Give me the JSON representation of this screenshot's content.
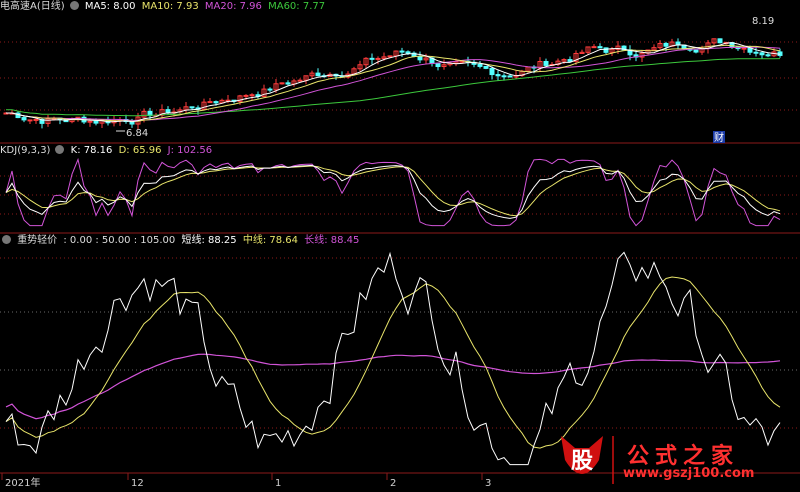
{
  "colors": {
    "bg": "#000000",
    "up": "#ff3c3c",
    "down": "#54ffff",
    "ma5": "#ffffff",
    "ma10": "#e8e46a",
    "ma20": "#d254d8",
    "ma60": "#3cc83c",
    "k": "#ffffff",
    "d": "#e8e46a",
    "j": "#d254d8",
    "short": "#ffffff",
    "mid": "#e8e46a",
    "long": "#d254d8",
    "grid": "#8b1a1a",
    "gridDot": "#6a6a6a",
    "axis": "#8b1a1a"
  },
  "panel1": {
    "title": "电高速A(日线)",
    "settings_icon": "gear-icon",
    "ma5": "MA5: 8.00",
    "ma10": "MA10: 7.93",
    "ma20": "MA20: 7.96",
    "ma60": "MA60: 7.77",
    "low_label": "6.84",
    "high_label": "8.19",
    "event_label": "财"
  },
  "panel2": {
    "title": "KDJ(9,3,3)",
    "settings_icon": "gear-icon",
    "k": "K: 78.16",
    "d": "D: 65.96",
    "j": "J: 102.56"
  },
  "panel3": {
    "title": "重势轻价",
    "settings_icon": "gear-icon",
    "levels": ": 0.00 : 50.00 : 105.00",
    "short": "短线: 88.25",
    "mid": "中线: 78.64",
    "long": "长线: 88.45"
  },
  "xaxis": {
    "labels": [
      "2021年",
      "12",
      "1",
      "2",
      "3"
    ]
  },
  "watermark": {
    "char": "股",
    "text": "公式之家",
    "url": "www.gszj100.com"
  },
  "chart_data": [
    {
      "type": "candlestick",
      "title": "电高速A(日线)",
      "series": [
        {
          "name": "MA5",
          "value": 8.0
        },
        {
          "name": "MA10",
          "value": 7.93
        },
        {
          "name": "MA20",
          "value": 7.96
        },
        {
          "name": "MA60",
          "value": 7.77
        }
      ],
      "annotations": [
        "6.84",
        "8.19",
        "财"
      ],
      "low": 6.84,
      "high": 8.19
    },
    {
      "type": "line",
      "title": "KDJ(9,3,3)",
      "series": [
        {
          "name": "K",
          "value": 78.16
        },
        {
          "name": "D",
          "value": 65.96
        },
        {
          "name": "J",
          "value": 102.56
        }
      ]
    },
    {
      "type": "line",
      "title": "重势轻价",
      "reference_levels": [
        0,
        50,
        105
      ],
      "series": [
        {
          "name": "短线",
          "value": 88.25
        },
        {
          "name": "中线",
          "value": 78.64
        },
        {
          "name": "长线",
          "value": 88.45
        }
      ]
    }
  ]
}
